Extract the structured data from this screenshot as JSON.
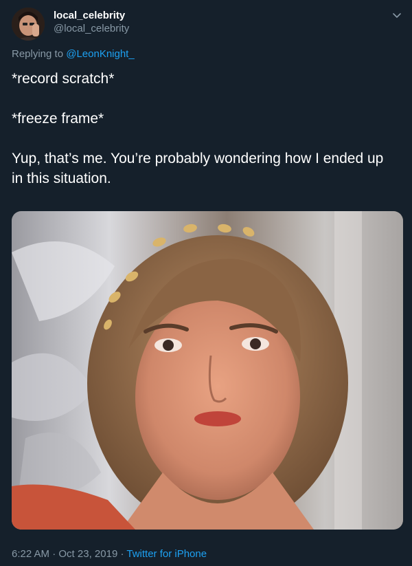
{
  "author": {
    "display_name": "local_celebrity",
    "handle": "@local_celebrity",
    "avatar_icon": "avatar-photo"
  },
  "reply": {
    "prefix": "Replying to ",
    "mention": "@LeonKnight_"
  },
  "tweet": {
    "line1": "*record scratch*",
    "line2": "*freeze frame*",
    "line3": "Yup, that’s me. You’re probably wondering how I ended up in this situation."
  },
  "media": {
    "icon": "photo-image"
  },
  "meta": {
    "time": "6:22 AM",
    "sep1": " · ",
    "date": "Oct 23, 2019",
    "sep2": " · ",
    "source": "Twitter for iPhone"
  },
  "menu": {
    "icon": "chevron-down-icon"
  },
  "colors": {
    "background": "#15202b",
    "secondary_text": "#8899a6",
    "link": "#1da1f2"
  }
}
